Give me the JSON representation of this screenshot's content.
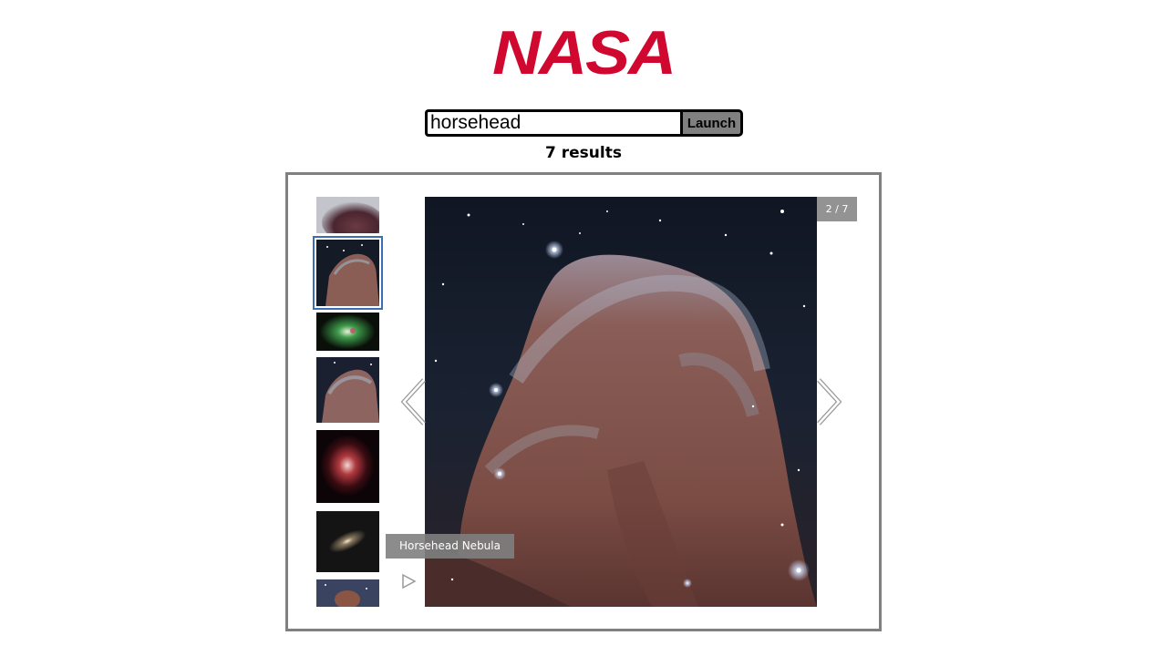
{
  "logo": {
    "text": "NASA",
    "color": "#d0082f"
  },
  "search": {
    "value": "horsehead",
    "placeholder": "",
    "button_label": "Launch"
  },
  "results": {
    "count_label": "7 results"
  },
  "gallery": {
    "counter": "2 / 7",
    "caption": "Horsehead Nebula",
    "active_index": 2,
    "total": 7,
    "thumbnails": [
      {
        "subject": "horsehead-nebula-closeup"
      },
      {
        "subject": "horsehead-nebula"
      },
      {
        "subject": "green-nebula"
      },
      {
        "subject": "horsehead-nebula"
      },
      {
        "subject": "red-nebula"
      },
      {
        "subject": "galaxy"
      },
      {
        "subject": "nebula"
      }
    ]
  },
  "colors": {
    "accent_border": "#3a6fb4",
    "frame_border": "#808080",
    "button_bg": "#808080"
  },
  "icons": {
    "prev": "chevron-left-icon",
    "next": "chevron-right-icon",
    "play": "play-icon"
  }
}
